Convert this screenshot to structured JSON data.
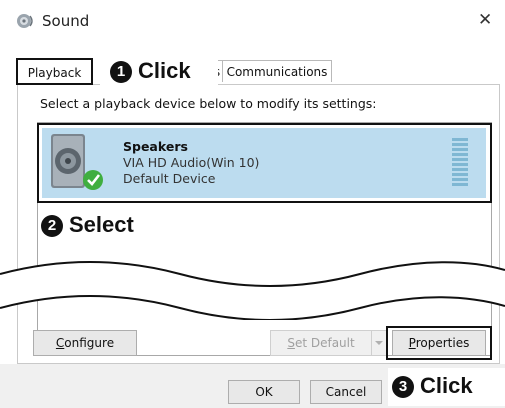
{
  "window": {
    "title": "Sound",
    "close_label": "✕"
  },
  "tabs": {
    "playback": "Playback",
    "hidden_fragment": "s",
    "communications": "Communications"
  },
  "instruction": "Select a playback device below to modify its settings:",
  "device": {
    "name": "Speakers",
    "driver": "VIA HD Audio(Win 10)",
    "status": "Default Device"
  },
  "annotations": {
    "step1": {
      "number": "1",
      "text": "Click"
    },
    "step2": {
      "number": "2",
      "text": "Select"
    },
    "step3": {
      "number": "3",
      "text": "Click"
    }
  },
  "buttons": {
    "configure_mnemonic": "C",
    "configure_rest": "onfigure",
    "set_default_mnemonic": "S",
    "set_default_rest": "et Default",
    "properties_mnemonic": "P",
    "properties_rest": "roperties",
    "ok": "OK",
    "cancel": "Cancel"
  },
  "colors": {
    "selection": "#bcdcef",
    "check_green": "#3fae3f"
  }
}
